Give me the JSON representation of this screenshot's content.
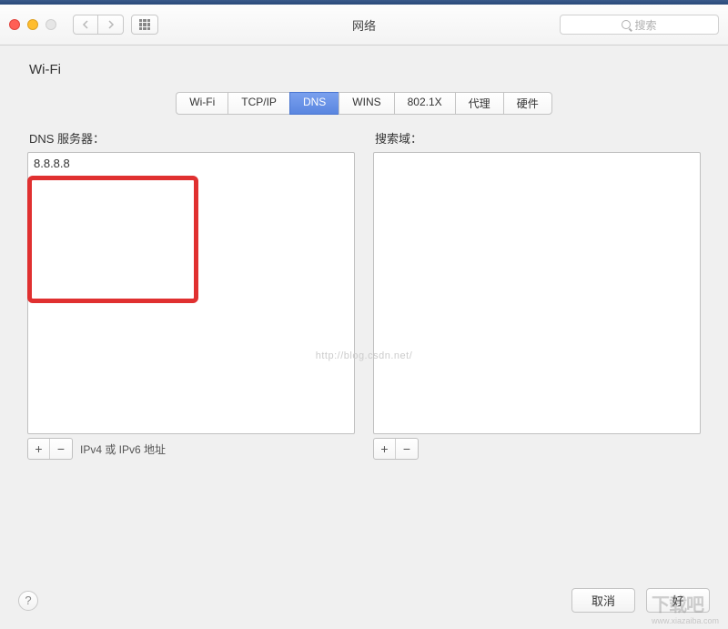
{
  "window": {
    "title": "网络"
  },
  "search": {
    "placeholder": "搜索"
  },
  "header": {
    "connection_label": "Wi-Fi"
  },
  "tabs": [
    {
      "label": "Wi-Fi",
      "active": false
    },
    {
      "label": "TCP/IP",
      "active": false
    },
    {
      "label": "DNS",
      "active": true
    },
    {
      "label": "WINS",
      "active": false
    },
    {
      "label": "802.1X",
      "active": false
    },
    {
      "label": "代理",
      "active": false
    },
    {
      "label": "硬件",
      "active": false
    }
  ],
  "dns": {
    "label": "DNS 服务器：",
    "servers": [
      "8.8.8.8"
    ],
    "hint": "IPv4 或 IPv6 地址"
  },
  "search_domains": {
    "label": "搜索域：",
    "domains": []
  },
  "watermark": "http://blog.csdn.net/",
  "footer": {
    "cancel": "取消",
    "ok": "好"
  },
  "site_watermark": {
    "main": "下载吧",
    "sub": "www.xiazaiba.com"
  }
}
